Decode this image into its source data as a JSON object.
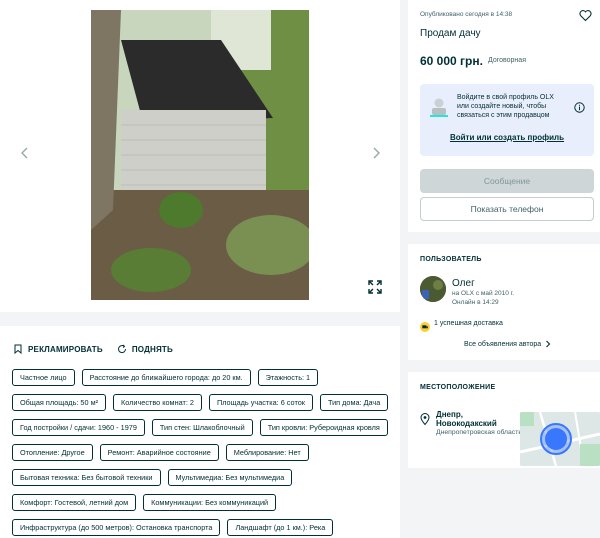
{
  "gallery": {
    "prev_icon": "chevron-left-icon",
    "next_icon": "chevron-right-icon",
    "expand_icon": "expand-icon"
  },
  "actions": {
    "promote_label": "РЕКЛАМИРОВАТЬ",
    "raise_label": "ПОДНЯТЬ"
  },
  "tags": [
    "Частное лицо",
    "Расстояние до ближайшего города: до 20 км.",
    "Этажность: 1",
    "Общая площадь: 50 м²",
    "Количество комнат: 2",
    "Площадь участка: 6 соток",
    "Тип дома: Дача",
    "Год постройки / сдачи: 1960 - 1979",
    "Тип стен: Шлакоблочный",
    "Тип кровли: Рубероидная кровля",
    "Отопление: Другое",
    "Ремонт: Аварийное состояние",
    "Меблирование: Нет",
    "Бытовая техника: Без бытовой техники",
    "Мультимедиа: Без мультимедиа",
    "Комфорт: Гостевой, летний дом",
    "Коммуникации: Без коммуникаций",
    "Инфраструктура (до 500 метров): Остановка транспорта",
    "Ландшафт (до 1 км.): Река"
  ],
  "offer": {
    "published": "Опубликовано сегодня в 14:38",
    "title": "Продам дачу",
    "price": "60 000 грн.",
    "negotiable": "Договорная",
    "login_text": "Войдите в свой профиль OLX или создайте новый, чтобы связаться с этим продавцом",
    "login_link": "Войти или создать профиль",
    "message_button": "Сообщение",
    "phone_button": "Показать телефон"
  },
  "seller": {
    "heading": "ПОЛЬЗОВАТЕЛЬ",
    "name": "Олег",
    "since": "на OLX с май 2010 г.",
    "online": "Онлайн в 14:29",
    "delivery": "1 успешная доставка",
    "all_ads": "Все объявления автора"
  },
  "location": {
    "heading": "МЕСТОПОЛОЖЕНИЕ",
    "city": "Днепр, Новокодакский",
    "region": "Днепропетровская область"
  },
  "colors": {
    "primary": "#002f34",
    "info_bg": "#e8eefc",
    "disabled_button": "#ced6d7",
    "map_marker": "#3a77ff",
    "delivery_badge": "#ffce32"
  }
}
